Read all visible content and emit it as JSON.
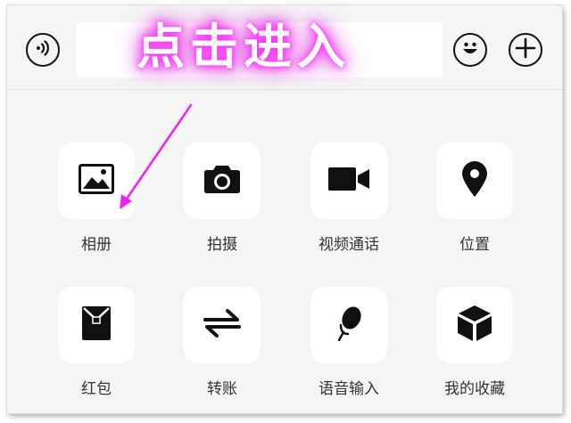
{
  "annotation": {
    "text": "点击进入",
    "glow_color": "#ff33ff"
  },
  "input": {
    "value": ""
  },
  "topbar": {
    "voice_icon": "voice-icon",
    "emoji_icon": "emoji-icon",
    "plus_icon": "plus-icon"
  },
  "panel": {
    "items": [
      {
        "label": "相册",
        "icon": "album-icon"
      },
      {
        "label": "拍摄",
        "icon": "camera-icon"
      },
      {
        "label": "视频通话",
        "icon": "video-call-icon"
      },
      {
        "label": "位置",
        "icon": "location-icon"
      },
      {
        "label": "红包",
        "icon": "red-packet-icon"
      },
      {
        "label": "转账",
        "icon": "transfer-icon"
      },
      {
        "label": "语音输入",
        "icon": "microphone-icon"
      },
      {
        "label": "我的收藏",
        "icon": "favorites-icon"
      }
    ]
  }
}
